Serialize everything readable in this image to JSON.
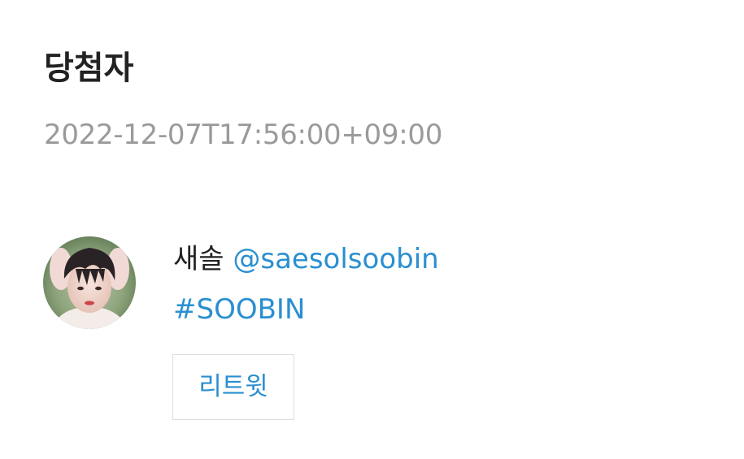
{
  "header": {
    "title": "당첨자",
    "timestamp": "2022-12-07T17:56:00+09:00"
  },
  "winner": {
    "display_name": "새솔",
    "handle": "@saesolsoobin",
    "hashtag": "#SOOBIN",
    "avatar_icon": "user-photo-avatar"
  },
  "actions": {
    "retweet_label": "리트윗"
  },
  "colors": {
    "text": "#222222",
    "muted": "#9a9a9a",
    "link": "#2a8fd0",
    "border": "#dcdcdc"
  }
}
